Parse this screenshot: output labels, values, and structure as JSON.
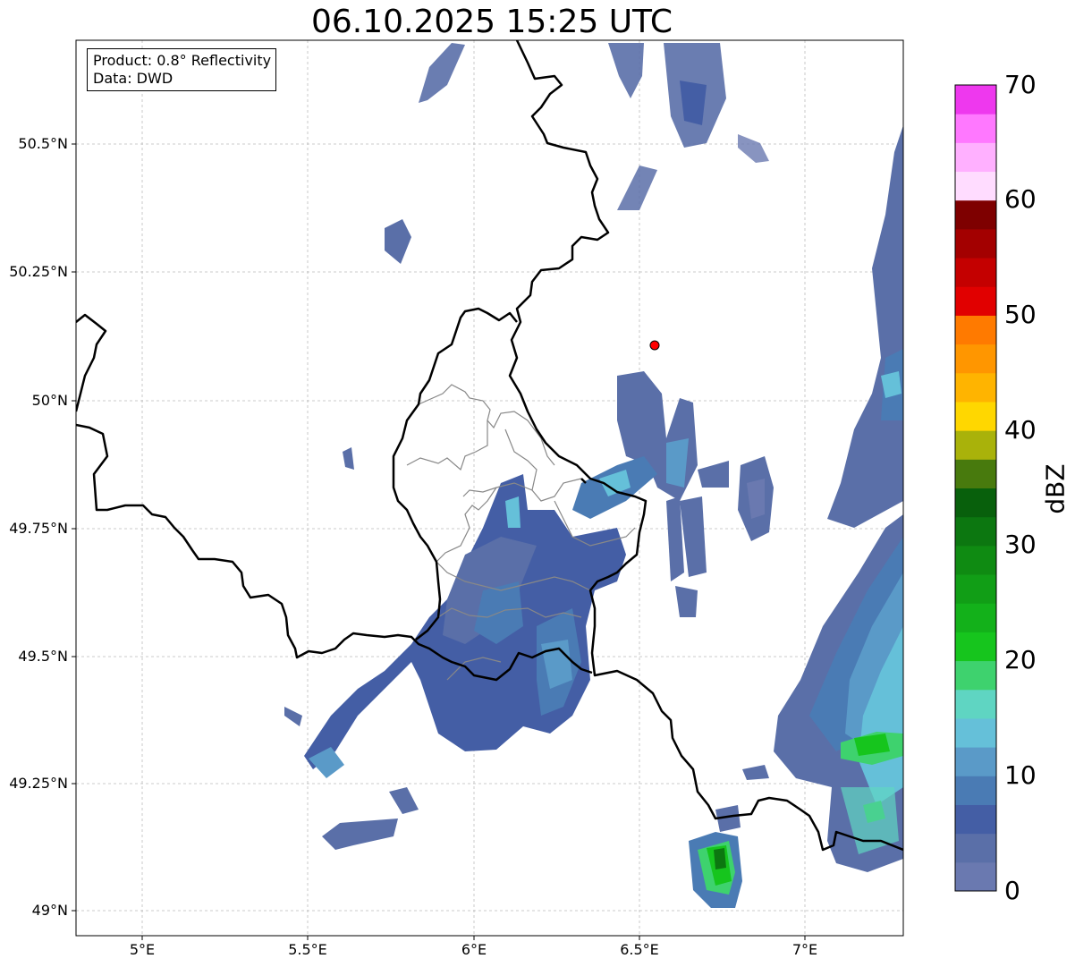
{
  "title": "06.10.2025 15:25 UTC",
  "infobox": {
    "product": "Product: 0.8° Reflectivity",
    "data": "Data: DWD"
  },
  "axes": {
    "y_labels": [
      "50.5°N",
      "50.25°N",
      "50°N",
      "49.75°N",
      "49.5°N",
      "49.25°N",
      "49°N"
    ],
    "x_labels": [
      "5°E",
      "5.5°E",
      "6°E",
      "6.5°E",
      "7°E"
    ]
  },
  "colorbar": {
    "label": "dBZ",
    "ticks": [
      "0",
      "10",
      "20",
      "30",
      "40",
      "50",
      "60",
      "70"
    ],
    "colors": [
      "#6a79b0",
      "#5a6fa8",
      "#445ea5",
      "#4a7bb4",
      "#5a9ac8",
      "#65c0d9",
      "#5fd5c2",
      "#3ed26e",
      "#16c51d",
      "#13b11a",
      "#119e16",
      "#0f8b12",
      "#0c7710",
      "#08600c",
      "#487a0d",
      "#a9b20a",
      "#ffd700",
      "#ffb400",
      "#ff9600",
      "#ff7a00",
      "#e10000",
      "#c40000",
      "#a30000",
      "#7e0000",
      "#ffdcff",
      "#ffb0ff",
      "#ff78ff",
      "#ee38ee"
    ]
  },
  "colors": {
    "border": "#000000",
    "district": "#888888",
    "radar_site": "#ff0000"
  }
}
